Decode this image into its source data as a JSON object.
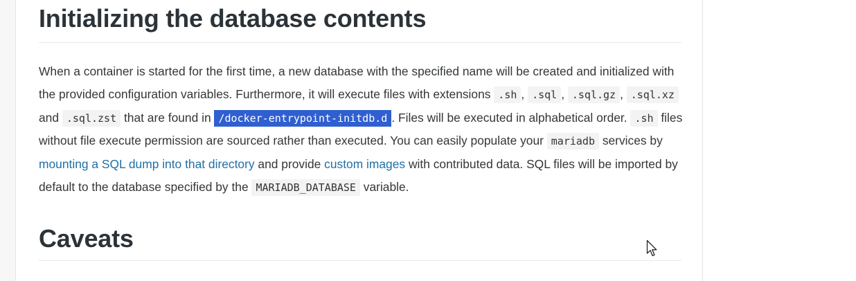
{
  "section1": {
    "heading": "Initializing the database contents",
    "p1": "When a container is started for the first time, a new database with the specified name will be created and initialized with the provided configuration variables. Furthermore, it will execute files with extensions ",
    "ext_sh": ".sh",
    "sep1": ", ",
    "ext_sql": ".sql",
    "sep2": ", ",
    "ext_sql_gz": ".sql.gz",
    "sep3": ", ",
    "ext_sql_xz": ".sql.xz",
    "and": " and ",
    "ext_sql_zst": ".sql.zst",
    "found_in": " that are found in ",
    "initdb_path": "/docker-entrypoint-initdb.d",
    "files_exec": ". Files will be executed in alphabetical order. ",
    "sh2": ".sh",
    "without_perm": " files without file execute permission are sourced rather than executed. You can easily populate your ",
    "mariadb": "mariadb",
    "services_by": " services by ",
    "link_mount": "mounting a SQL dump into that directory",
    "and_provide": " and provide ",
    "link_custom": "custom images",
    "contributed": " with contributed data. SQL files will be imported by default to the database specified by the ",
    "mariadb_database": "MARIADB_DATABASE",
    "variable": " variable."
  },
  "section2": {
    "heading": "Caveats"
  },
  "colors": {
    "link": "#1f6fa8",
    "selection": "#2f5fd0",
    "code_bg": "#f3f3f3"
  },
  "cursor": {
    "icon": "mouse-pointer-icon"
  }
}
